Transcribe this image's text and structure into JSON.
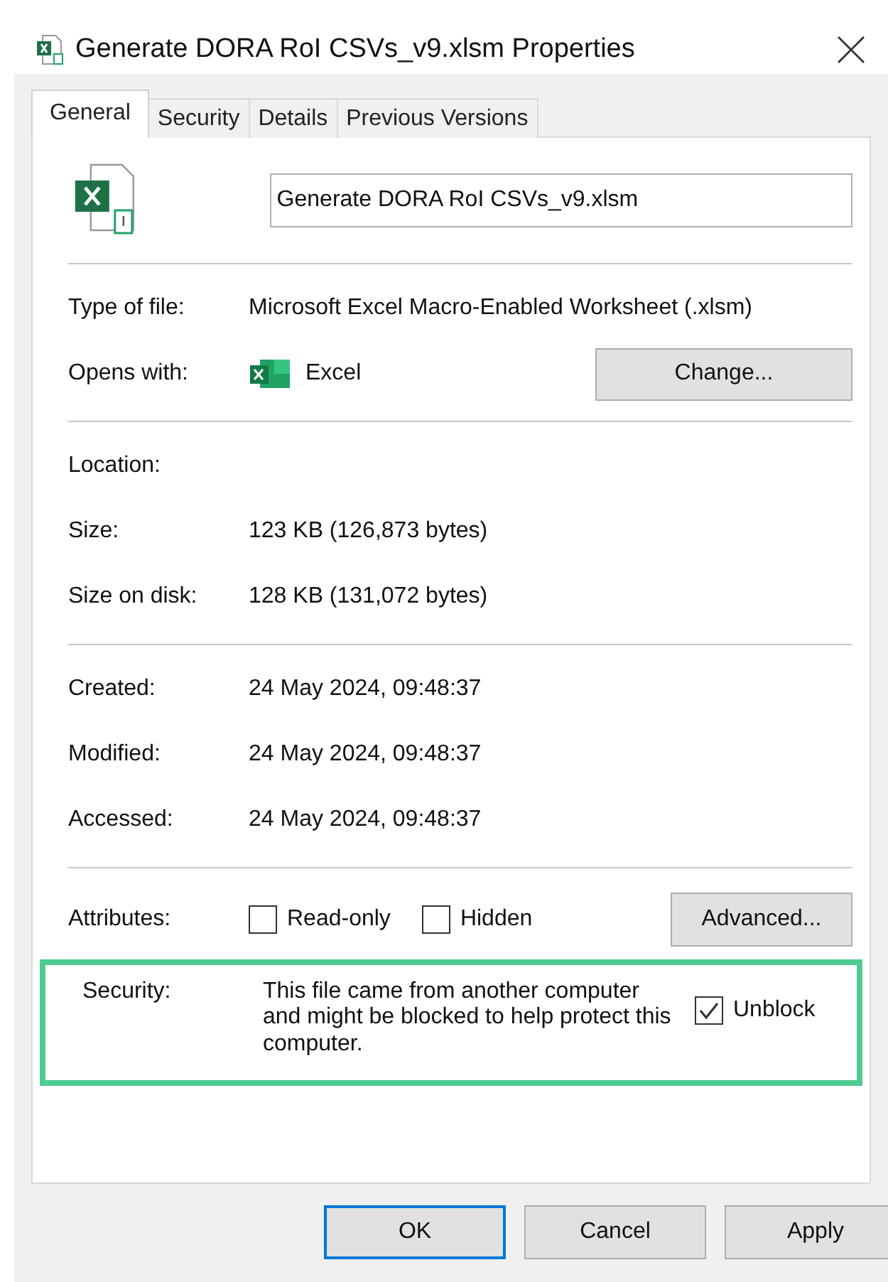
{
  "window": {
    "title": "Generate DORA RoI CSVs_v9.xlsm Properties"
  },
  "tabs": [
    {
      "label": "General",
      "selected": true
    },
    {
      "label": "Security",
      "selected": false
    },
    {
      "label": "Details",
      "selected": false
    },
    {
      "label": "Previous Versions",
      "selected": false
    }
  ],
  "file_name": "Generate DORA RoI CSVs_v9.xlsm",
  "sections": [
    [
      {
        "kind": "text",
        "label": "Type of file:",
        "value": "Microsoft Excel Macro-Enabled Worksheet (.xlsm)"
      },
      {
        "kind": "app",
        "label": "Opens with:",
        "value": "Excel",
        "button": "Change..."
      }
    ],
    [
      {
        "kind": "text",
        "label": "Location:"
      },
      {
        "kind": "text",
        "label": "Size:",
        "value": "123 KB (126,873 bytes)"
      },
      {
        "kind": "text",
        "label": "Size on disk:",
        "value": "128 KB (131,072 bytes)"
      }
    ],
    [
      {
        "kind": "text",
        "label": "Created:",
        "value": "24 May 2024, 09:48:37"
      },
      {
        "kind": "text",
        "label": "Modified:",
        "value": "24 May 2024, 09:48:37"
      },
      {
        "kind": "text",
        "label": "Accessed:",
        "value": "24 May 2024, 09:48:37"
      }
    ],
    [
      {
        "kind": "attributes",
        "label": "Attributes:",
        "checkboxes": [
          {
            "label": "Read-only",
            "checked": false
          },
          {
            "label": "Hidden",
            "checked": false
          }
        ],
        "button": "Advanced..."
      },
      {
        "kind": "security",
        "label": "Security:",
        "value": "This file came from another computer and might be blocked to help protect this computer.",
        "checkbox": {
          "label": "Unblock",
          "checked": true
        },
        "highlighted": true
      }
    ]
  ],
  "buttons": [
    {
      "label": "OK",
      "default": true
    },
    {
      "label": "Cancel",
      "default": false
    },
    {
      "label": "Apply",
      "default": false
    }
  ]
}
